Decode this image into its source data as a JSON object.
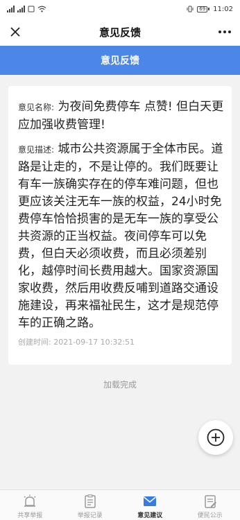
{
  "status_bar": {
    "battery": "69",
    "time": "11:02"
  },
  "nav": {
    "title": "意见反馈"
  },
  "header": {
    "title": "意见反馈"
  },
  "feedback": {
    "name_label": "意见名称:",
    "name_value": "为夜间免费停车 点赞! 但白天更应加强收费管理!",
    "desc_label": "意见描述:",
    "desc_value": "城市公共资源属于全体市民。道路是让走的，不是让停的。我们既要让有车一族确实存在的停车难问题，但也更应该关注无车一族的权益，24小时免费停车恰恰损害的是无车一族的享受公共资源的正当权益。夜间停车可以免费，但白天必须收费，而且必须差别化，越停时间长费用越大。国家资源国家收费，然后用收费反哺到道路交通设施建设，再来福祉民生，这才是规范停车的正确之路。",
    "created_label": "创建时间:",
    "created_value": "2021-09-17 10:32:51"
  },
  "list_footer": "加载完成",
  "tabs": [
    {
      "label": "共享举报",
      "icon": "alarm-icon",
      "active": false
    },
    {
      "label": "举报记录",
      "icon": "clipboard-icon",
      "active": false
    },
    {
      "label": "意见建议",
      "icon": "mail-icon",
      "active": true
    },
    {
      "label": "便民公示",
      "icon": "notice-icon",
      "active": false
    }
  ],
  "colors": {
    "brand_blue": "#4c87e8",
    "active_icon": "#3a7be0",
    "inactive": "#999999"
  }
}
